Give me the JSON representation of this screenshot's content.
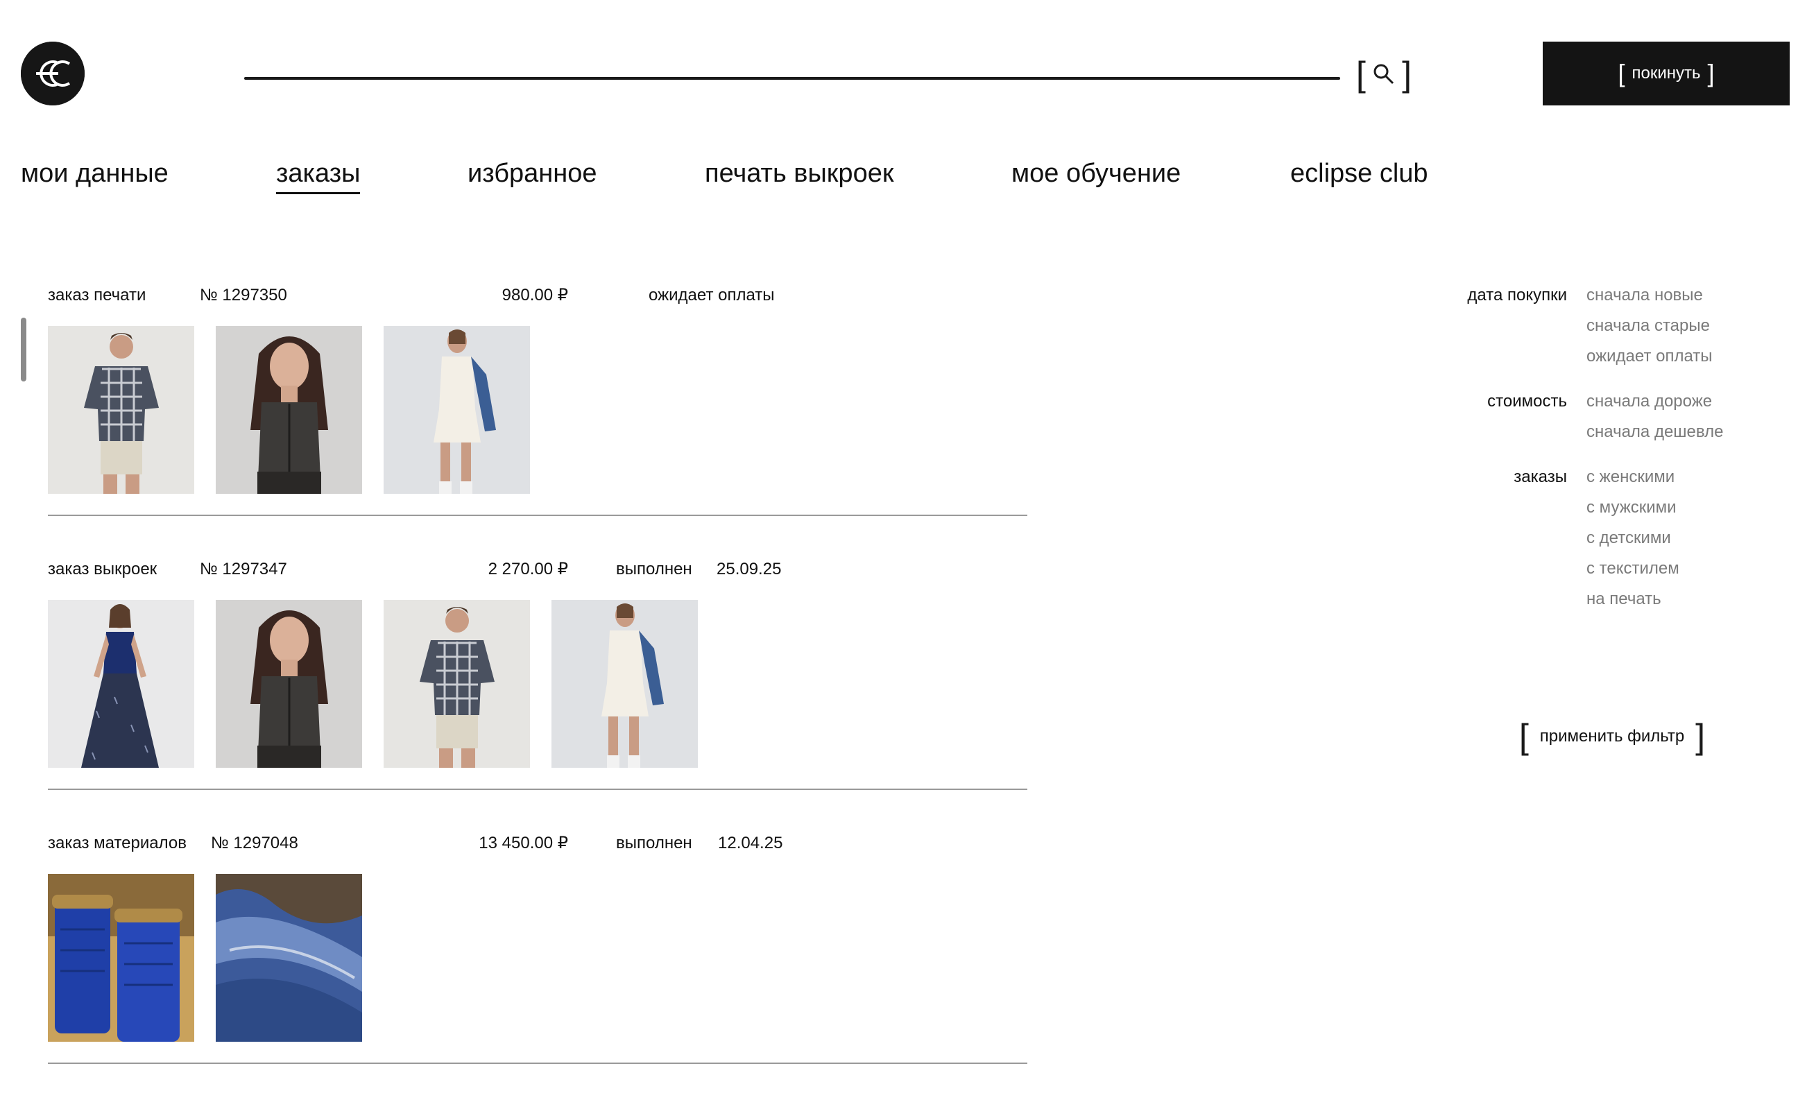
{
  "header": {
    "logo_alt": "ec",
    "exit_label": "покинуть",
    "search_value": ""
  },
  "tabs": [
    {
      "label": "мои данные",
      "active": false
    },
    {
      "label": "заказы",
      "active": true
    },
    {
      "label": "избранное",
      "active": false
    },
    {
      "label": "печать выкроек",
      "active": false
    },
    {
      "label": "мое обучение",
      "active": false
    },
    {
      "label": "eclipse club",
      "active": false
    }
  ],
  "orders": [
    {
      "type": "заказ печати",
      "number": "№ 1297350",
      "price": "980.00 ₽",
      "status": "ожидает оплаты",
      "date": "",
      "items": [
        "мужчина в клетчатой рубашке и шортах",
        "девушка в тёмном топе",
        "девушка в белом комбинезоне и синем кардигане"
      ]
    },
    {
      "type": "заказ выкроек",
      "number": "№ 1297347",
      "price": "2 270.00 ₽",
      "status": "выполнен",
      "date": "25.09.25",
      "items": [
        "девушка в бархатном жилете и юбке",
        "девушка в тёмном топе",
        "мужчина в клетчатой рубашке и шортах",
        "девушка в белом комбинезоне и синем кардигане"
      ]
    },
    {
      "type": "заказ материалов",
      "number": "№ 1297048",
      "price": "13 450.00 ₽",
      "status": "выполнен",
      "date": "12.04.25",
      "items": [
        "синие нитки на катушках",
        "синяя ткань"
      ]
    }
  ],
  "filter": {
    "groups": [
      {
        "label": "дата покупки",
        "options": [
          "сначала новые",
          "сначала старые",
          "ожидает оплаты"
        ]
      },
      {
        "label": "стоимость",
        "options": [
          "сначала дороже",
          "сначала дешевле"
        ]
      },
      {
        "label": "заказы",
        "options": [
          "с женскими",
          "с мужскими",
          "с детскими",
          "с текстилем",
          "на печать"
        ]
      }
    ],
    "apply_label": "применить фильтр"
  },
  "colors": {
    "text": "#111111",
    "muted": "#7a7a7a",
    "button_bg": "#141414",
    "divider": "#9a9a9a"
  }
}
